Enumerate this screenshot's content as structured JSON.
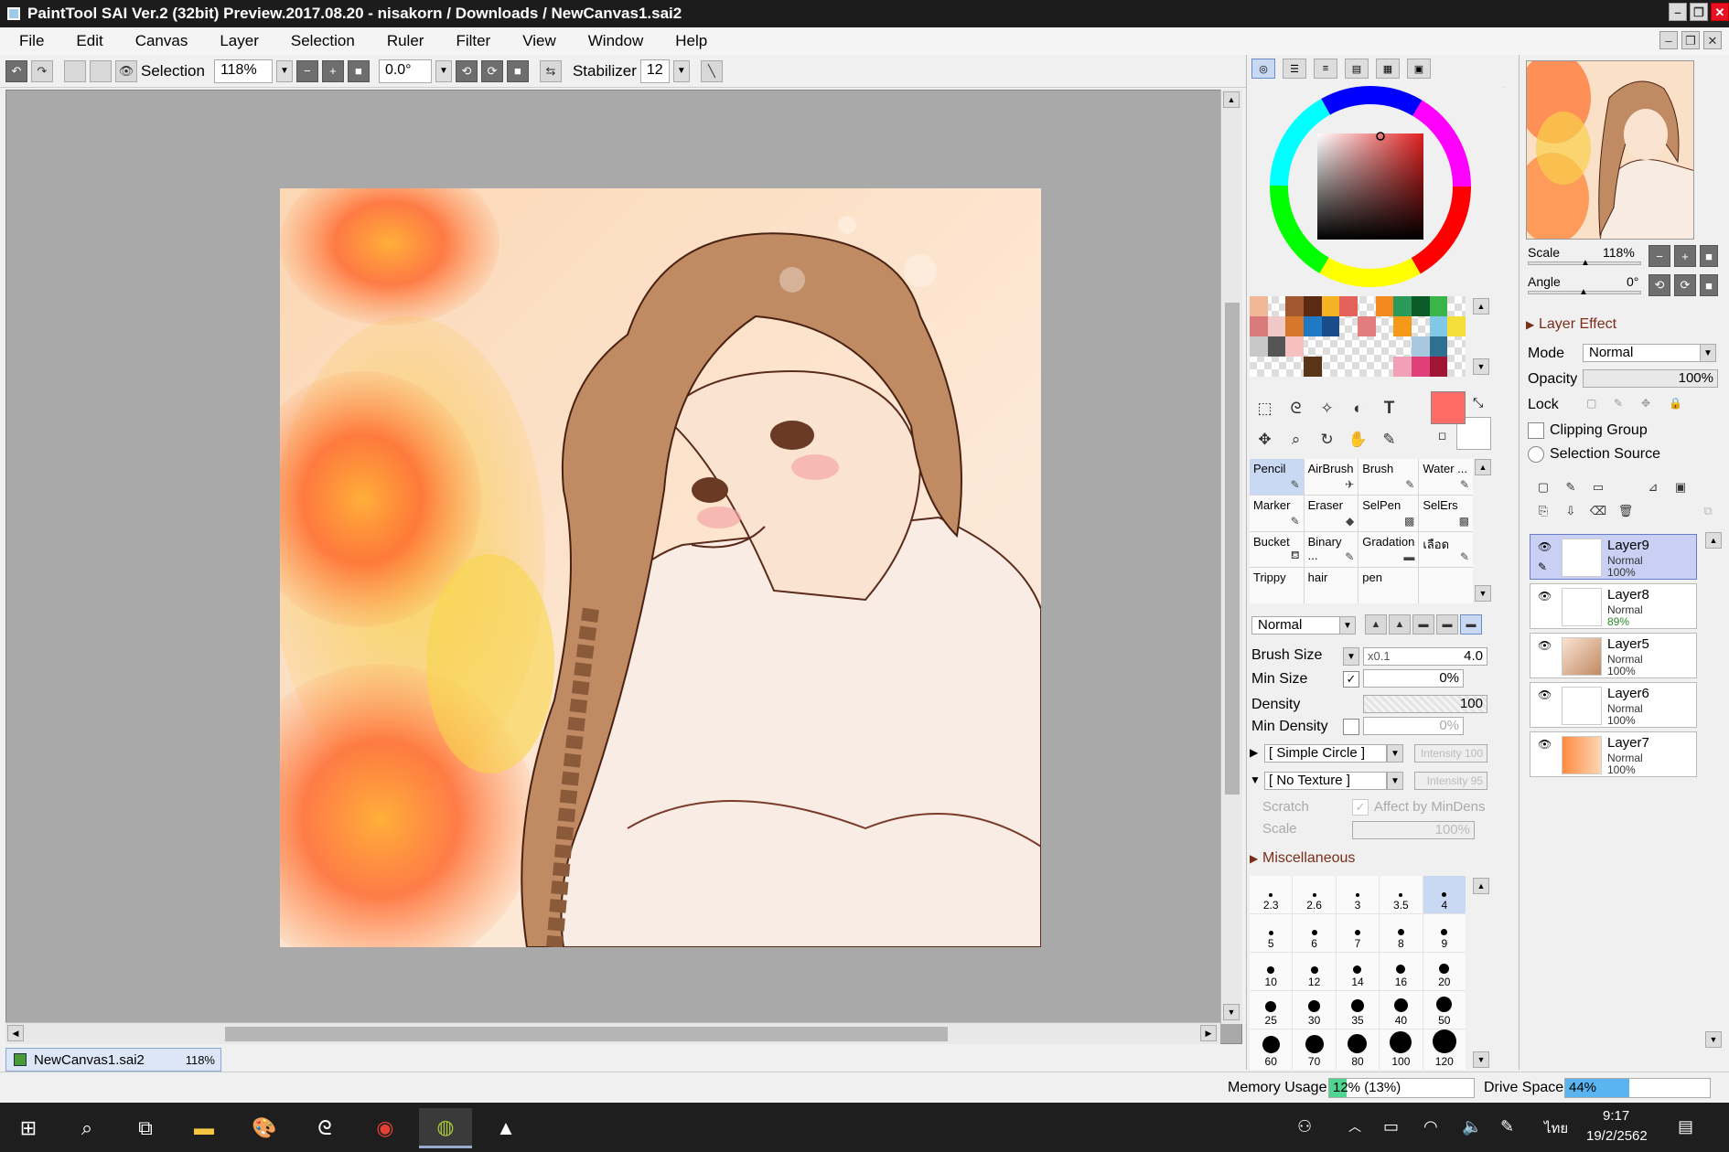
{
  "window": {
    "title": "PaintTool SAI Ver.2 (32bit) Preview.2017.08.20 - nisakorn / Downloads / NewCanvas1.sai2"
  },
  "menu": [
    "File",
    "Edit",
    "Canvas",
    "Layer",
    "Selection",
    "Ruler",
    "Filter",
    "View",
    "Window",
    "Help"
  ],
  "toolbar": {
    "selection_label": "Selection",
    "zoom": "118%",
    "angle": "0.0°",
    "stabilizer_label": "Stabilizer",
    "stabilizer_value": "12"
  },
  "document": {
    "tab_name": "NewCanvas1.sai2",
    "tab_zoom": "118%"
  },
  "tools": {
    "text_tool": "T"
  },
  "brushes": [
    {
      "name": "Pencil",
      "active": true
    },
    {
      "name": "AirBrush"
    },
    {
      "name": "Brush"
    },
    {
      "name": "Water ..."
    },
    {
      "name": "Marker"
    },
    {
      "name": "Eraser"
    },
    {
      "name": "SelPen"
    },
    {
      "name": "SelErs"
    },
    {
      "name": "Bucket"
    },
    {
      "name": "Binary ..."
    },
    {
      "name": "Gradation"
    },
    {
      "name": "เลือด"
    },
    {
      "name": "Trippy"
    },
    {
      "name": "hair"
    },
    {
      "name": "pen"
    },
    {
      "name": ""
    }
  ],
  "brush_settings": {
    "blend_mode": "Normal",
    "brush_size_label": "Brush Size",
    "brush_size_mult": "x0.1",
    "brush_size": "4.0",
    "min_size_label": "Min Size",
    "min_size": "0%",
    "density_label": "Density",
    "density": "100",
    "min_density_label": "Min Density",
    "min_density": "0%",
    "shape": "[ Simple Circle ]",
    "shape_intensity": "Intensity 100",
    "texture": "[ No Texture ]",
    "texture_intensity": "Intensity 95",
    "scratch_label": "Scratch",
    "affect_label": "Affect by MinDens",
    "scale_label": "Scale",
    "scale_value": "100%",
    "misc_label": "Miscellaneous"
  },
  "brush_sizes": [
    "2.3",
    "2.6",
    "3",
    "3.5",
    "4",
    "5",
    "6",
    "7",
    "8",
    "9",
    "10",
    "12",
    "14",
    "16",
    "20",
    "25",
    "30",
    "35",
    "40",
    "50",
    "60",
    "70",
    "80",
    "100",
    "120"
  ],
  "selected_brush_size": "4",
  "navigator": {
    "scale_label": "Scale",
    "scale_value": "118%",
    "angle_label": "Angle",
    "angle_value": "0°"
  },
  "layer_effect": {
    "header": "Layer Effect",
    "mode_label": "Mode",
    "mode_value": "Normal",
    "opacity_label": "Opacity",
    "opacity_value": "100%",
    "lock_label": "Lock",
    "clipping_label": "Clipping Group",
    "selection_source_label": "Selection Source"
  },
  "layers": [
    {
      "name": "Layer9",
      "mode": "Normal",
      "opacity": "100%",
      "selected": true
    },
    {
      "name": "Layer8",
      "mode": "Normal",
      "opacity": "89%"
    },
    {
      "name": "Layer5",
      "mode": "Normal",
      "opacity": "100%"
    },
    {
      "name": "Layer6",
      "mode": "Normal",
      "opacity": "100%"
    },
    {
      "name": "Layer7",
      "mode": "Normal",
      "opacity": "100%"
    }
  ],
  "status": {
    "memory_label": "Memory Usage",
    "memory_value": "12% (13%)",
    "memory_fraction": 0.12,
    "drive_label": "Drive Space",
    "drive_value": "44%",
    "drive_fraction": 0.44
  },
  "taskbar": {
    "time": "9:17",
    "date": "19/2/2562",
    "lang": "ไทย"
  },
  "colors": {
    "accent": "#c9d9f4",
    "foreground": "#ff6b66",
    "background": "#ffffff",
    "memory_bar": "#4ed48f",
    "drive_bar": "#5ab4f0"
  }
}
